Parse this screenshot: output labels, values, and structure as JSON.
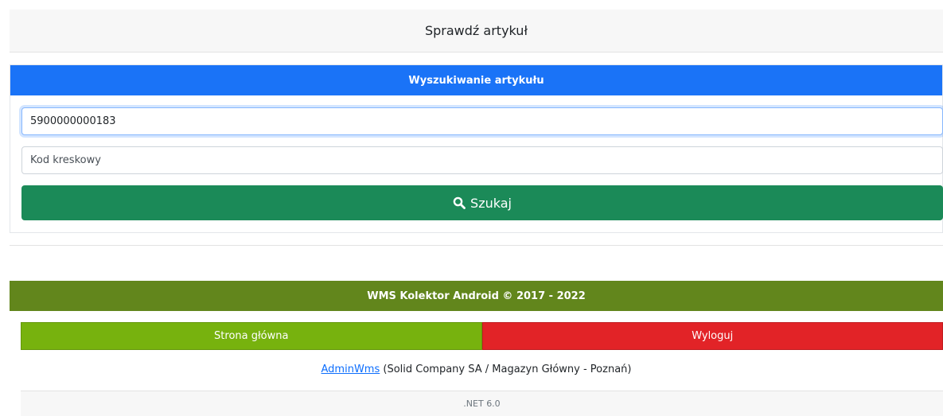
{
  "header": {
    "title": "Sprawdź artykuł"
  },
  "search_card": {
    "title": "Wyszukiwanie artykułu",
    "barcode_value": "5900000000183",
    "barcode_placeholder": "Kod kreskowy",
    "search_label": "Szukaj",
    "search_icon": "search-icon"
  },
  "footer": {
    "title": "WMS Kolektor Android © 2017 - 2022",
    "home_label": "Strona główna",
    "logout_label": "Wyloguj",
    "user_link": "AdminWms",
    "company_text": " (Solid Company SA / Magazyn Główny - Poznań)",
    "version": ".NET 6.0"
  },
  "colors": {
    "primary": "#1a73f7",
    "success": "#1b8a58",
    "footer_header": "#62861c",
    "home": "#77b20e",
    "logout": "#e22327"
  }
}
